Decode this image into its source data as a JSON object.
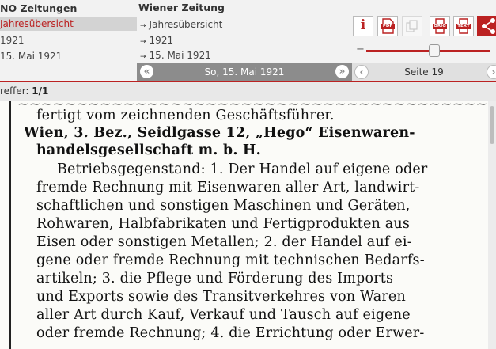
{
  "left_column": {
    "title": "NO Zeitungen",
    "nav_active": "Jahresübersicht",
    "nav_year": "1921",
    "nav_date": "15. Mai 1921"
  },
  "middle_column": {
    "title": "Wiener Zeitung",
    "nav_overview": "Jahresübersicht",
    "nav_year": "1921",
    "nav_date": "15. Mai 1921",
    "nav_arrow": "→"
  },
  "date_bar": {
    "date": "So, 15. Mai 1921",
    "prev": "«",
    "next": "»"
  },
  "page_bar": {
    "page": "Seite 19",
    "prev": "‹",
    "next": "›"
  },
  "toolbar": {
    "info_label": "i",
    "pdf_label": "PDF",
    "orig_label": "ORIG",
    "text_label": "TEXT"
  },
  "zoom": {
    "level": 0.55
  },
  "hits": {
    "label": "reffer:",
    "value": "1/1"
  },
  "article": {
    "lines": [
      "fertigt vom zeichnenden Geschäftsführer.",
      "Wien, 3. Bez., Seidlgasse 12, „Hego“ Eisenwaren-",
      "handelsgesellschaft m. b. H.",
      "Betriebsgegenstand: 1. Der Handel auf eigene oder",
      "fremde Rechnung mit Eisenwaren aller Art, landwirt-",
      "schaftlichen und sonstigen Maschinen und Geräten,",
      "Rohwaren, Halbfabrikaten und Fertigprodukten aus",
      "Eisen oder sonstigen Metallen; 2. der Handel auf ei-",
      "gene oder fremde Rechnung mit technischen Bedarfs-",
      "artikeln; 3. die Pflege und Förderung des Imports",
      "und Exports sowie des Transitverkehres von Waren",
      "aller Art durch Kauf, Verkauf und Tausch auf eigene",
      "oder fremde Rechnung; 4. die Errichtung oder Erwer-"
    ]
  },
  "colors": {
    "accent": "#b22222",
    "date_bar": "#8c8c8c",
    "top_background": "#f2f2f2"
  }
}
